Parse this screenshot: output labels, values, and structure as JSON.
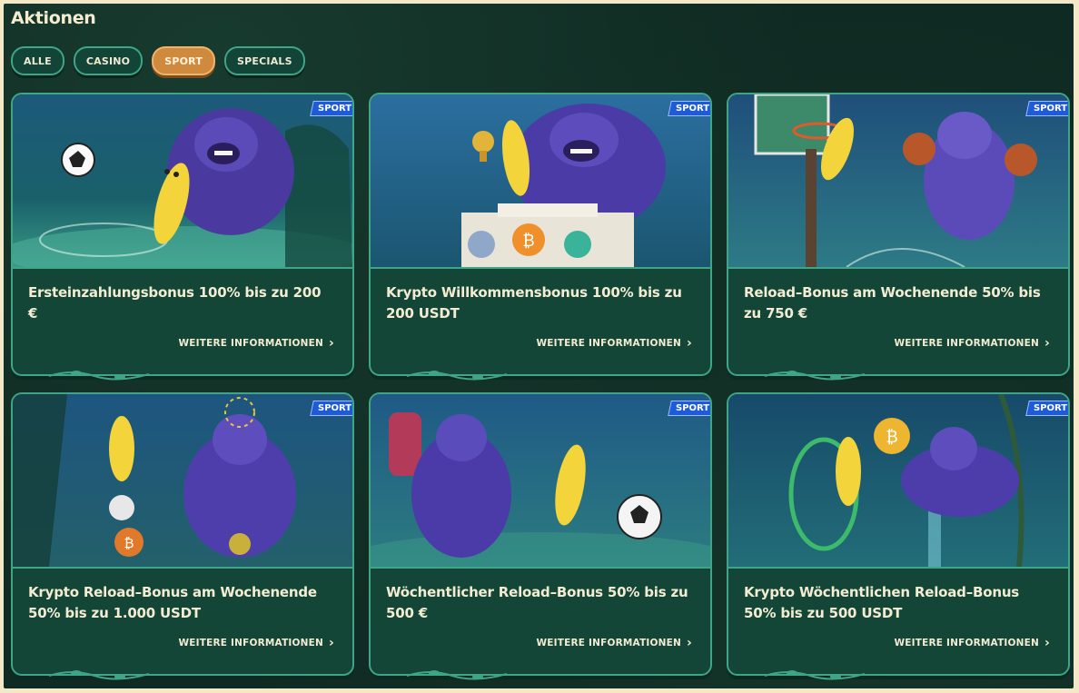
{
  "page": {
    "title": "Aktionen"
  },
  "filters": [
    {
      "label": "ALLE",
      "active": false
    },
    {
      "label": "CASINO",
      "active": false
    },
    {
      "label": "SPORT",
      "active": true
    },
    {
      "label": "SPECIALS",
      "active": false
    }
  ],
  "cards": [
    {
      "badge": "SPORT",
      "title": "Ersteinzahlungsbonus 100% bis zu 200 €",
      "more": "WEITERE INFORMATIONEN",
      "art": "gorilla-banana-soccer"
    },
    {
      "badge": "SPORT",
      "title": "Krypto Willkommensbonus 100% bis zu 200 USDT",
      "more": "WEITERE INFORMATIONEN",
      "art": "banana-trophy-crypto-podium"
    },
    {
      "badge": "SPORT",
      "title": "Reload–Bonus am Wochenende 50% bis zu 750 €",
      "more": "WEITERE INFORMATIONEN",
      "art": "banana-basketball-hoop"
    },
    {
      "badge": "SPORT",
      "title": "Krypto Reload–Bonus am Wochenende 50% bis zu 1.000 USDT",
      "more": "WEITERE INFORMATIONEN",
      "art": "banana-juggling-crypto-coins"
    },
    {
      "badge": "SPORT",
      "title": "Wöchentlicher Reload–Bonus 50% bis zu 500 €",
      "more": "WEITERE INFORMATIONEN",
      "art": "gorilla-foam-finger-banana-kick"
    },
    {
      "badge": "SPORT",
      "title": "Krypto Wöchentlichen Reload–Bonus 50% bis zu 500 USDT",
      "more": "WEITERE INFORMATIONEN",
      "art": "gorilla-vine-bitcoin-banana"
    }
  ],
  "colors": {
    "background": "#0f2a22",
    "card": "#144637",
    "border": "#3fa586",
    "active": "#d08a3e",
    "badge": "#1e5bd8",
    "text": "#f3ecd2"
  },
  "icons": {
    "more": "chevron-right-icon"
  }
}
